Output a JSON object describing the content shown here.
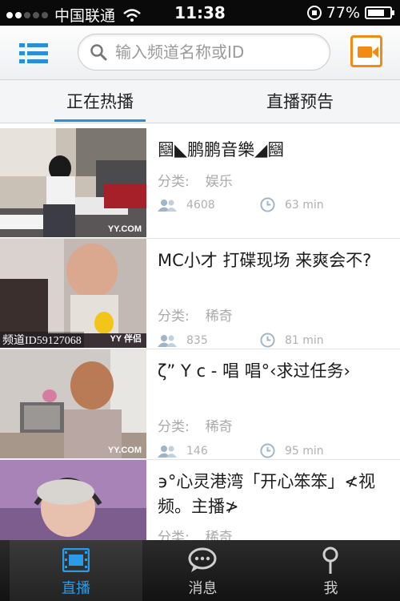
{
  "status_bar": {
    "carrier": "中国联通",
    "time": "11:38",
    "battery_percent": "77%",
    "battery_level": 0.77
  },
  "top_bar": {
    "search_placeholder": "输入频道名称或ID"
  },
  "tabs": [
    {
      "label": "正在热播",
      "active": true
    },
    {
      "label": "直播预告",
      "active": false
    }
  ],
  "channels": [
    {
      "title": "圝◣鹏鹏音樂◢圝",
      "category_label": "分类:",
      "category": "娱乐",
      "viewers": "4608",
      "duration": "63 min",
      "watermark": "YY.COM",
      "channel_id": ""
    },
    {
      "title": "MC小才 打碟现场 来爽会不?",
      "category_label": "分类:",
      "category": "稀奇",
      "viewers": "835",
      "duration": "81 min",
      "watermark": "YY 伴侣",
      "channel_id": "频道ID59127068"
    },
    {
      "title": "ζ”    Υ c - 唱  唱°‹求过任务›",
      "category_label": "分类:",
      "category": "稀奇",
      "viewers": "146",
      "duration": "95 min",
      "watermark": "YY.COM",
      "channel_id": ""
    },
    {
      "title": "϶°心灵港湾「开心笨笨」≮视频。主播≯",
      "category_label": "分类:",
      "category": "稀奇",
      "viewers": "",
      "duration": "",
      "watermark": "",
      "channel_id": ""
    }
  ],
  "bottom_nav": [
    {
      "label": "直播",
      "icon": "film-icon",
      "active": true
    },
    {
      "label": "消息",
      "icon": "chat-bubble-icon",
      "active": false
    },
    {
      "label": "我",
      "icon": "person-icon",
      "active": false
    }
  ],
  "colors": {
    "accent_blue": "#2a8fd8",
    "camera_orange": "#f28a14"
  }
}
